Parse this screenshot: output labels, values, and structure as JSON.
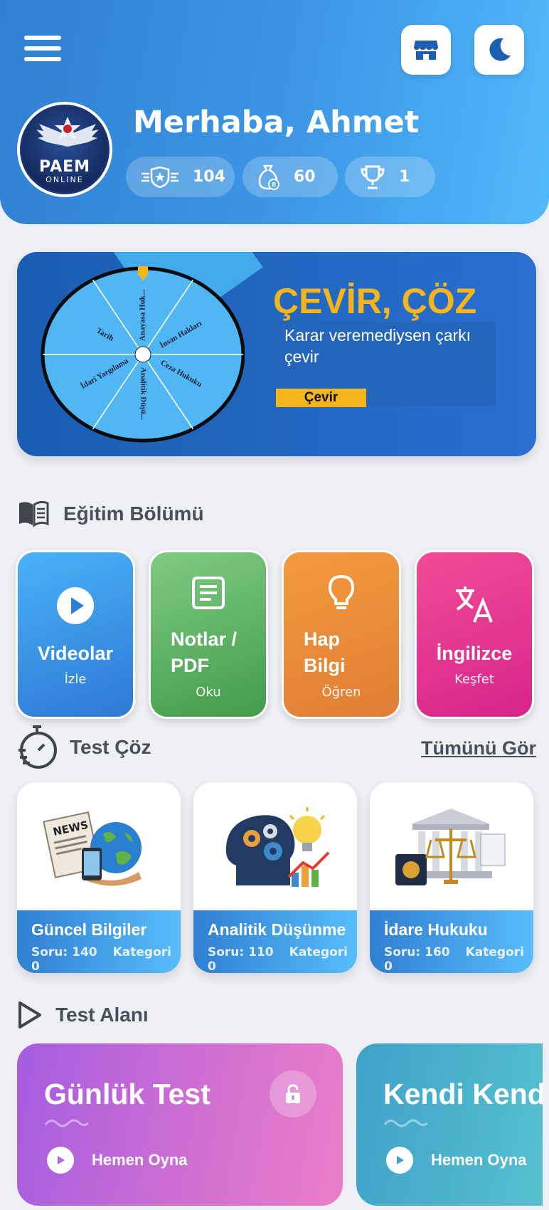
{
  "header": {
    "greeting": "Merhaba, Ahmet",
    "logo": {
      "title": "PAEM",
      "subtitle": "ONLINE"
    },
    "stats": [
      {
        "icon": "rank-badge-icon",
        "value": "104"
      },
      {
        "icon": "coin-bag-icon",
        "value": "60"
      },
      {
        "icon": "trophy-icon",
        "value": "1"
      }
    ]
  },
  "wheel_banner": {
    "title": "ÇEVİR, ÇÖZ",
    "description": "Karar veremediysen çarkı çevir",
    "button_label": "Çevir",
    "segments": [
      "Anayasa Huk...",
      "İnsan Hakları",
      "Ceza Hukuku",
      "Analitik Düşü...",
      "İdari Yargılama",
      "Tarih"
    ]
  },
  "education": {
    "title": "Eğitim Bölümü",
    "cards": [
      {
        "title": "Videolar",
        "subtitle": "İzle",
        "color": "#3a8ae0"
      },
      {
        "title": "Notlar / PDF",
        "subtitle": "Oku",
        "color": "#5aab5d"
      },
      {
        "title": "Hap Bilgi",
        "subtitle": "Öğren",
        "color": "#ec8a37"
      },
      {
        "title": "İngilizce",
        "subtitle": "Keşfet",
        "color": "#e23f97"
      }
    ]
  },
  "tests": {
    "title": "Test Çöz",
    "see_all": "Tümünü Gör",
    "cards": [
      {
        "title": "Güncel Bilgiler",
        "count": "Soru: 140",
        "category": "Kategori 0"
      },
      {
        "title": "Analitik Düşünme",
        "count": "Soru: 110",
        "category": "Kategori 0"
      },
      {
        "title": "İdare Hukuku",
        "count": "Soru: 160",
        "category": "Kategori 0"
      }
    ]
  },
  "test_area": {
    "title": "Test Alanı",
    "cards": [
      {
        "title": "Günlük Test",
        "action": "Hemen Oyna",
        "locked": true
      },
      {
        "title": "Kendi Kendine",
        "action": "Hemen Oyna",
        "locked": false
      }
    ]
  }
}
